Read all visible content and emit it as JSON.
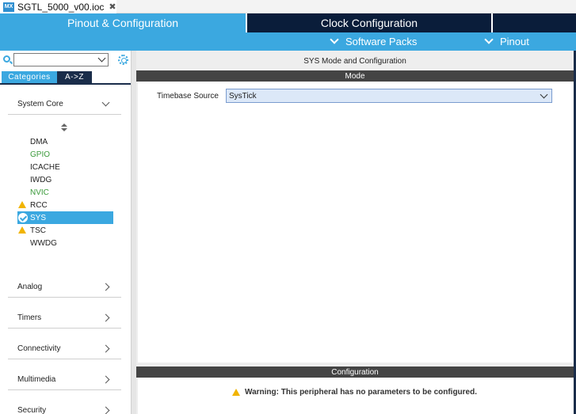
{
  "editor": {
    "icon_text": "MX",
    "file_tab": "SGTL_5000_v00.ioc",
    "close_glyph": "✖"
  },
  "nav": {
    "tabs": [
      {
        "label": "Pinout & Configuration"
      },
      {
        "label": "Clock Configuration"
      },
      {
        "label": ""
      }
    ],
    "sub": [
      {
        "label": "Software Packs"
      },
      {
        "label": "Pinout"
      }
    ]
  },
  "sidebar": {
    "search": {
      "value": "",
      "placeholder": ""
    },
    "tabs": [
      {
        "label": "Categories"
      },
      {
        "label": "A->Z"
      }
    ],
    "system_core": {
      "label": "System Core",
      "items": [
        {
          "label": "DMA",
          "status": "none"
        },
        {
          "label": "GPIO",
          "status": "configured"
        },
        {
          "label": "ICACHE",
          "status": "none"
        },
        {
          "label": "IWDG",
          "status": "none"
        },
        {
          "label": "NVIC",
          "status": "configured"
        },
        {
          "label": "RCC",
          "status": "warning"
        },
        {
          "label": "SYS",
          "status": "ok-selected"
        },
        {
          "label": "TSC",
          "status": "warning"
        },
        {
          "label": "WWDG",
          "status": "none"
        }
      ]
    },
    "categories": [
      {
        "label": "Analog"
      },
      {
        "label": "Timers"
      },
      {
        "label": "Connectivity"
      },
      {
        "label": "Multimedia"
      },
      {
        "label": "Security"
      }
    ]
  },
  "main": {
    "title": "SYS Mode and Configuration",
    "mode_header": "Mode",
    "timebase": {
      "label": "Timebase Source",
      "value": "SysTick"
    },
    "config_header": "Configuration",
    "warning": "Warning: This peripheral has no parameters to be configured."
  },
  "colors": {
    "accent": "#3ba8e0",
    "nav_dark": "#0a1d3a",
    "configured_green": "#3a9a3a",
    "warning_yellow": "#f1b400"
  }
}
